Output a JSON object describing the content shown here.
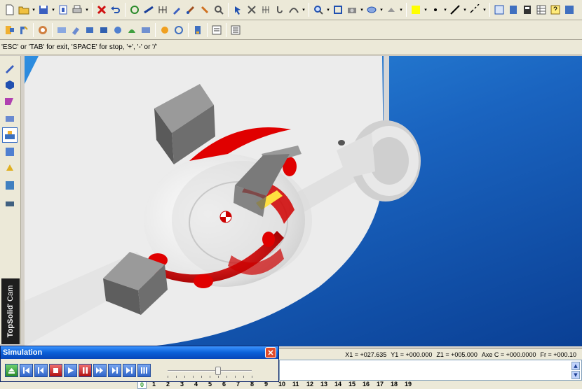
{
  "hint": "'ESC' or 'TAB' for exit, 'SPACE' for stop, '+', '-' or '/'",
  "brand": {
    "name": "TopSolid",
    "reg": "'",
    "module": "Cam"
  },
  "simulation": {
    "title": "Simulation",
    "close": "✕",
    "slider_position": 0.6
  },
  "status": {
    "x1": "X1 = +027.635",
    "y1": "Y1 = +000.000",
    "z1": "Z1 = +005.000",
    "axe_c": "Axe C = +000.0000",
    "fr": "Fr = +000.10"
  },
  "tabs": [
    "0",
    "1",
    "2",
    "3",
    "4",
    "5",
    "6",
    "7",
    "8",
    "9",
    "10",
    "11",
    "12",
    "13",
    "14",
    "15",
    "16",
    "17",
    "18",
    "19"
  ],
  "colors": {
    "viewport_bg": "#1a64c0",
    "part_red": "#e00000",
    "title_blue": "#0a5fd8"
  }
}
